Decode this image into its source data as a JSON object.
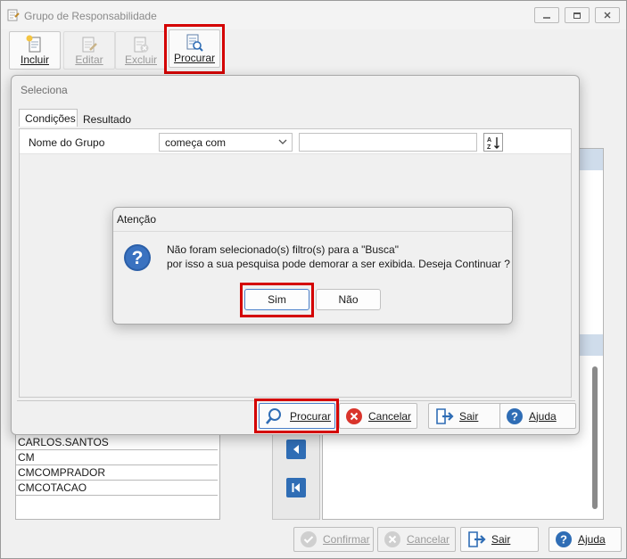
{
  "window": {
    "title": "Grupo de Responsabilidade"
  },
  "toolbar": {
    "incluir": "Incluir",
    "editar": "Editar",
    "excluir": "Excluir",
    "procurar": "Procurar"
  },
  "background_list": {
    "items": [
      "CARLOS.SANTOS",
      "CM",
      "CMCOMPRADOR",
      "CMCOTACAO"
    ]
  },
  "footer": {
    "confirmar": "Confirmar",
    "cancelar": "Cancelar",
    "sair": "Sair",
    "ajuda": "Ajuda"
  },
  "seleciona": {
    "title": "Seleciona",
    "tabs": [
      "Condições",
      "Resultado"
    ],
    "filter": {
      "field_label": "Nome do Grupo",
      "operator": "começa com",
      "value": ""
    },
    "buttons": {
      "procurar": "Procurar",
      "cancelar": "Cancelar",
      "sair": "Sair",
      "ajuda": "Ajuda"
    }
  },
  "atencao": {
    "title": "Atenção",
    "line1": "Não foram selecionado(s) filtro(s) para a \"Busca\"",
    "line2": "por isso a sua pesquisa pode demorar a ser exibida. Deseja Continuar ?",
    "sim": "Sim",
    "nao": "Não"
  },
  "colors": {
    "highlight": "#d40000",
    "accent_blue": "#2f6db5"
  }
}
